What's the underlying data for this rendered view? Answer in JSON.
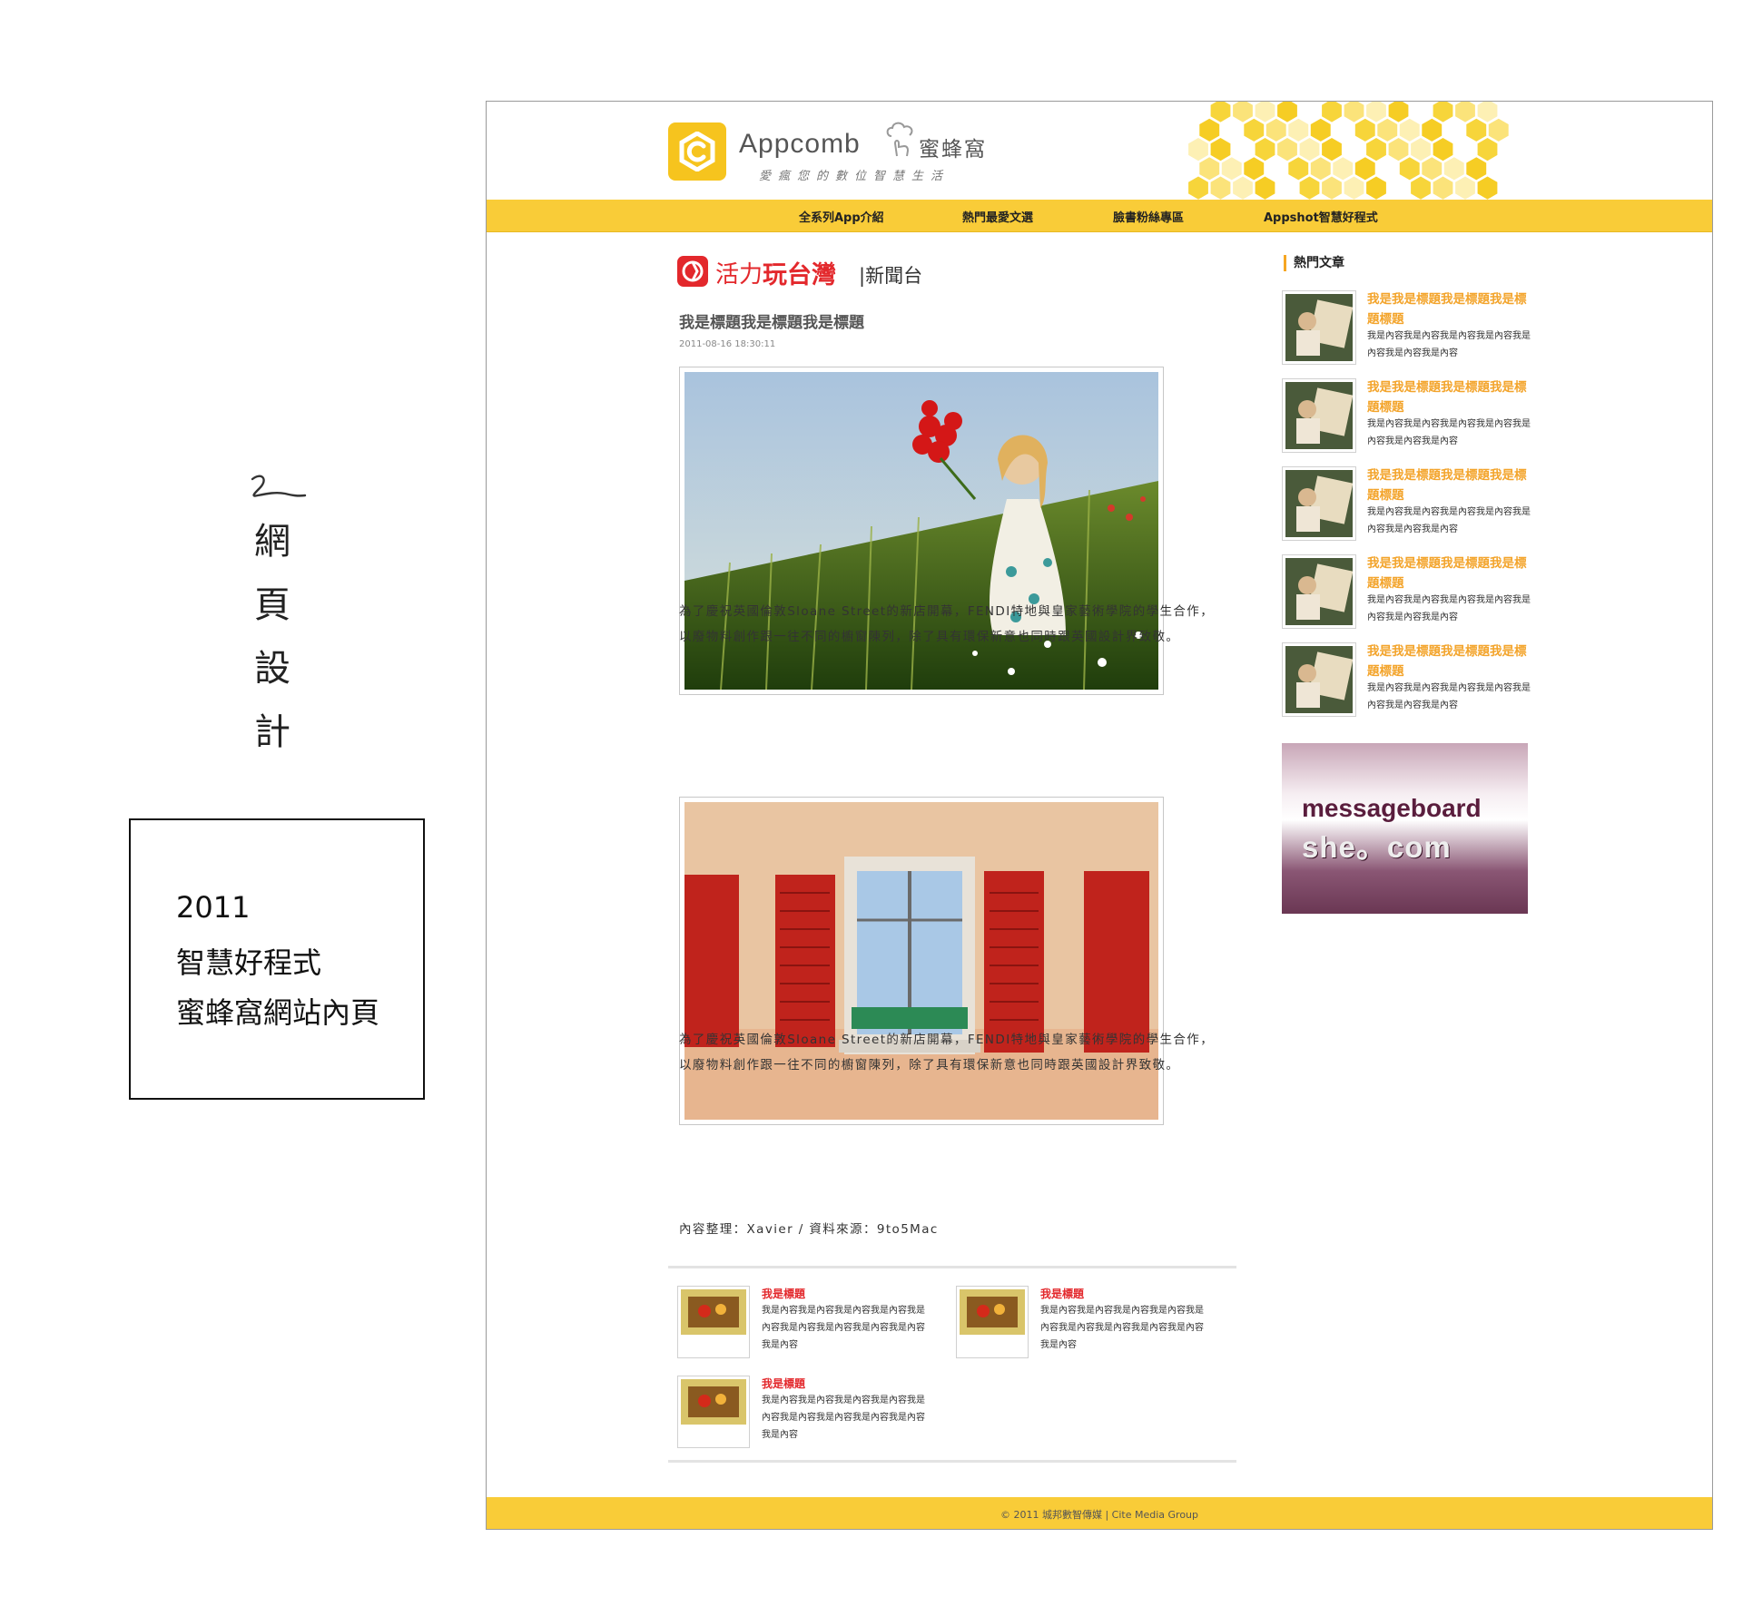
{
  "portfolio": {
    "number_mark": "2",
    "vertical_title": [
      "網",
      "頁",
      "設",
      "計"
    ],
    "info_lines": [
      "2011",
      "智慧好程式",
      "蜜蜂窩網站內頁"
    ]
  },
  "site": {
    "logo_text": "Appcomb",
    "logo_cn": "蜜蜂窩",
    "tagline": "愛瘋您的數位智慧生活",
    "nav": [
      "全系列App介紹",
      "熱門最愛文選",
      "臉書粉絲專區",
      "Appshot智慧好程式"
    ],
    "colors": {
      "accent": "#f9cc38",
      "red": "#e3282c",
      "orange": "#f3a42b"
    }
  },
  "article": {
    "brand_a": "活力",
    "brand_b": "玩台灣",
    "brand_c": "|新聞台",
    "title": "我是標題我是標題我是標題",
    "date": "2011-08-16 18:30:11",
    "para1": "為了慶祝英國倫敦Sloane Street的新店開幕，FENDI特地與皇家藝術學院的學生合作，以廢物料創作跟一往不同的櫥窗陳列，除了具有環保新意也同時跟英國設計界致敬。",
    "para2": "為了慶祝英國倫敦Sloane Street的新店開幕，FENDI特地與皇家藝術學院的學生合作，以廢物料創作跟一往不同的櫥窗陳列，除了具有環保新意也同時跟英國設計界致敬。",
    "credit": "內容整理：Xavier / 資料來源：9to5Mac"
  },
  "related": [
    {
      "title": "我是標題",
      "body": "我是內容我是內容我是內容我是內容我是內容我是內容我是內容我是內容我是內容我是內容"
    },
    {
      "title": "我是標題",
      "body": "我是內容我是內容我是內容我是內容我是內容我是內容我是內容我是內容我是內容我是內容"
    },
    {
      "title": "我是標題",
      "body": "我是內容我是內容我是內容我是內容我是內容我是內容我是內容我是內容我是內容我是內容"
    }
  ],
  "sidebar": {
    "heading": "熱門文章",
    "items": [
      {
        "title": "我是我是標題我是標題我是標題標題",
        "body": "我是內容我是內容我是內容我是內容我是內容我是內容我是內容"
      },
      {
        "title": "我是我是標題我是標題我是標題標題",
        "body": "我是內容我是內容我是內容我是內容我是內容我是內容我是內容"
      },
      {
        "title": "我是我是標題我是標題我是標題標題",
        "body": "我是內容我是內容我是內容我是內容我是內容我是內容我是內容"
      },
      {
        "title": "我是我是標題我是標題我是標題標題",
        "body": "我是內容我是內容我是內容我是內容我是內容我是內容我是內容"
      },
      {
        "title": "我是我是標題我是標題我是標題標題",
        "body": "我是內容我是內容我是內容我是內容我是內容我是內容我是內容"
      }
    ],
    "banner_line1": "messageboard",
    "banner_line2": "she。com"
  },
  "footer": "© 2011 城邦數智傳媒 | Cite Media Group"
}
